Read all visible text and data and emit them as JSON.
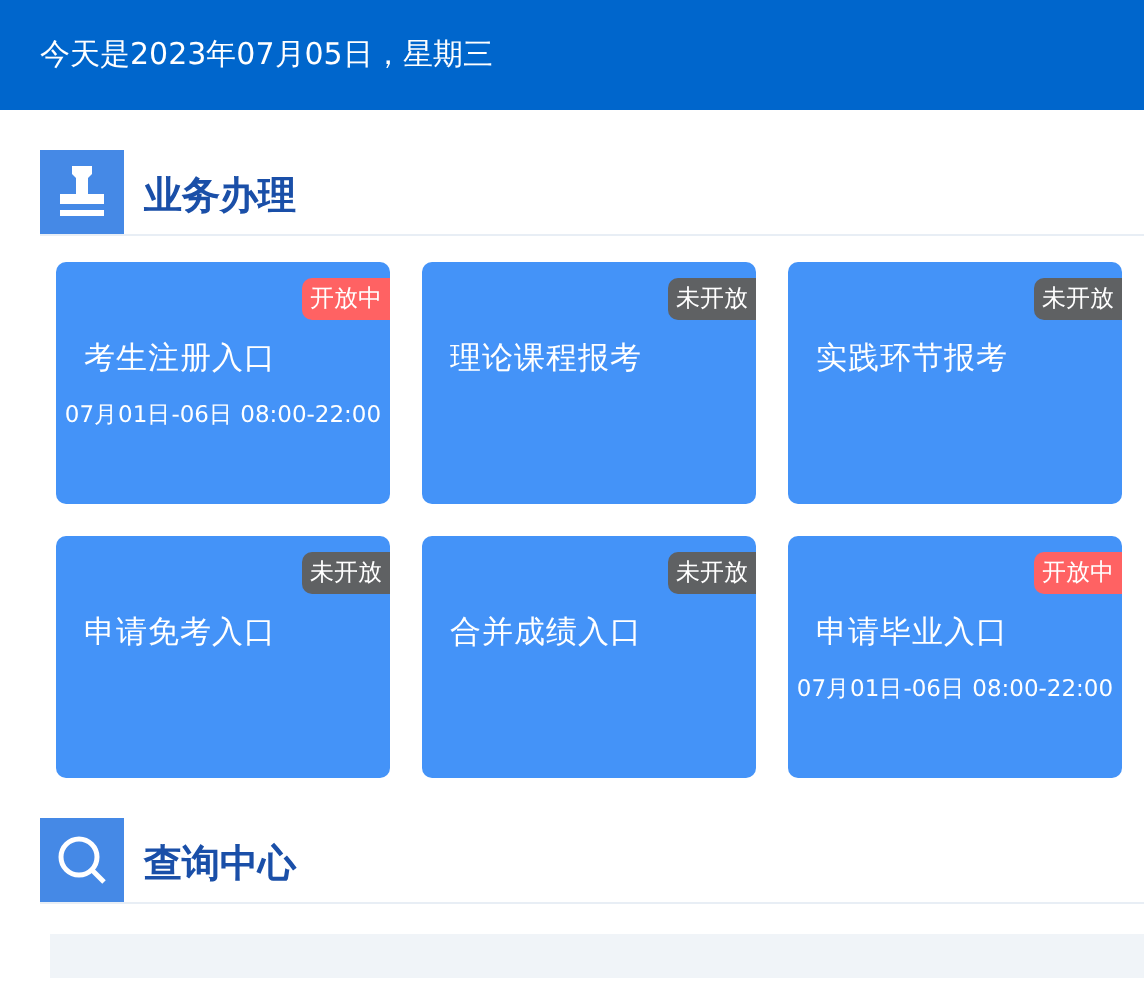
{
  "header": {
    "date_text": "今天是2023年07月05日，星期三"
  },
  "sections": [
    {
      "title": "业务办理",
      "kind": "stamp",
      "cards": [
        {
          "title": "考生注册入口",
          "status": "开放中",
          "open": true,
          "time": "07月01日-06日 08:00-22:00"
        },
        {
          "title": "理论课程报考",
          "status": "未开放",
          "open": false
        },
        {
          "title": "实践环节报考",
          "status": "未开放",
          "open": false
        },
        {
          "title": "申请免考入口",
          "status": "未开放",
          "open": false
        },
        {
          "title": "合并成绩入口",
          "status": "未开放",
          "open": false
        },
        {
          "title": "申请毕业入口",
          "status": "开放中",
          "open": true,
          "time": "07月01日-06日 08:00-22:00"
        }
      ]
    },
    {
      "title": "查询中心",
      "kind": "search"
    }
  ]
}
